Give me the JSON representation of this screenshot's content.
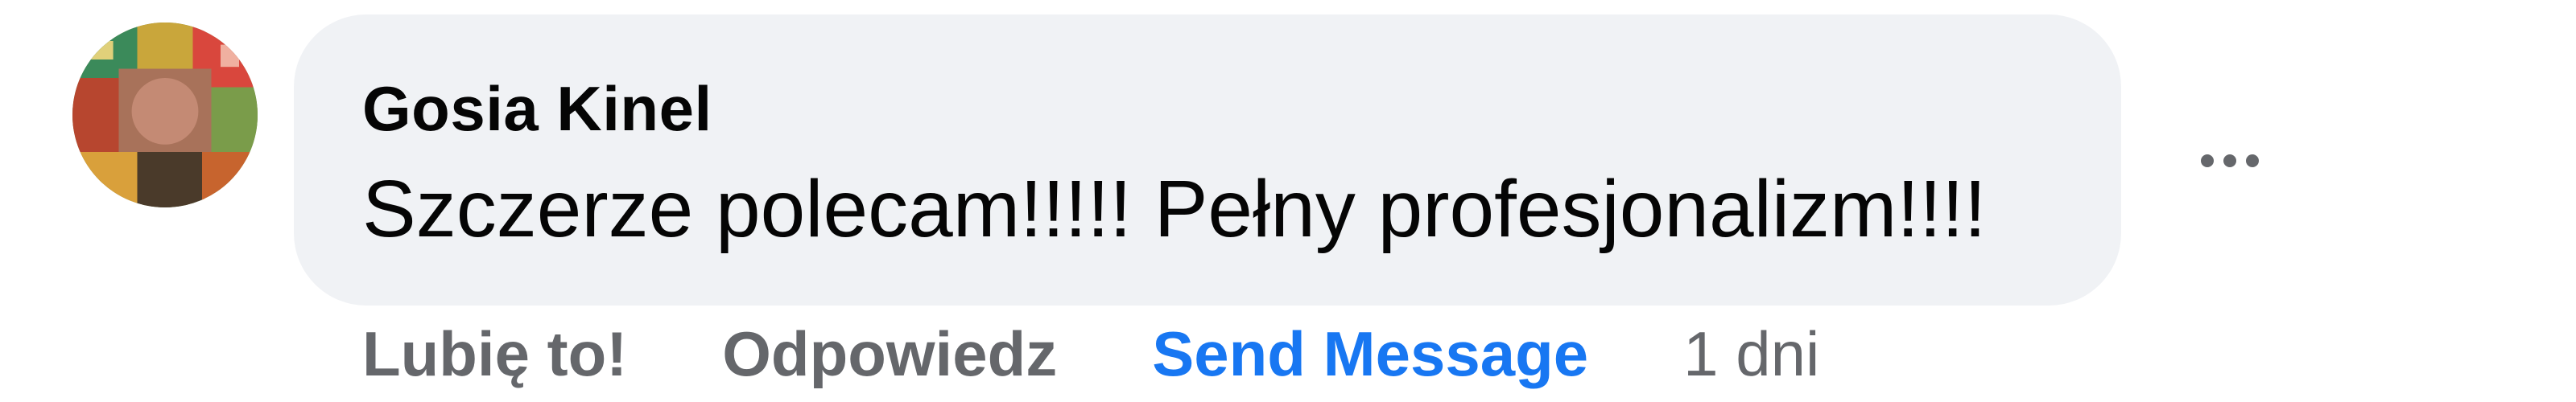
{
  "comment": {
    "author": "Gosia Kinel",
    "text": "Szczerze polecam!!!!! Pełny profesjonalizm!!!!",
    "actions": {
      "like": "Lubię to!",
      "reply": "Odpowiedz",
      "send_message": "Send Message"
    },
    "timestamp": "1 dni",
    "more_icon": "ellipsis-icon"
  },
  "colors": {
    "bubble_bg": "#f0f2f5",
    "text": "#050505",
    "secondary": "#65676b",
    "link": "#1877f2"
  }
}
